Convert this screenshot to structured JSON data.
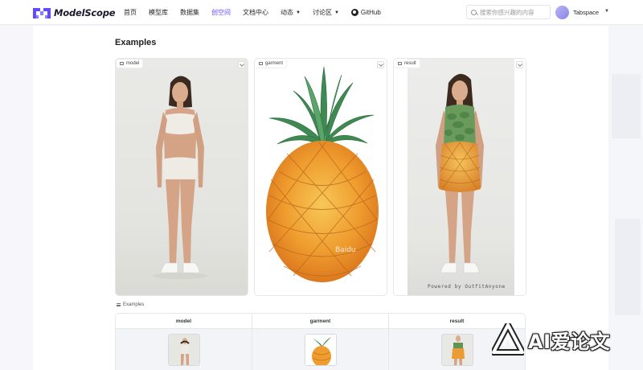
{
  "header": {
    "logo_text": "ModelScope",
    "nav": [
      {
        "label": "首页"
      },
      {
        "label": "模型库"
      },
      {
        "label": "数据集"
      },
      {
        "label": "创空间"
      },
      {
        "label": "文档中心"
      },
      {
        "label": "动态"
      },
      {
        "label": "讨论区"
      },
      {
        "label": "GitHub"
      }
    ],
    "active_nav": "创空间",
    "search_placeholder": "搜索你感兴趣的内容",
    "username": "Tabspace",
    "accent_color": "#624aff"
  },
  "examples_section": {
    "title": "Examples",
    "cards": [
      {
        "label": "model",
        "icon": "image-icon"
      },
      {
        "label": "garment",
        "icon": "image-icon"
      },
      {
        "label": "result",
        "icon": "image-icon"
      }
    ],
    "garment_watermark": "Baidu",
    "result_watermark": "Powered by OutfitAnyone"
  },
  "examples_table": {
    "label": "Examples",
    "columns": [
      "model",
      "garment",
      "result"
    ]
  },
  "brand_overlay": {
    "text": "AI爱论文"
  }
}
